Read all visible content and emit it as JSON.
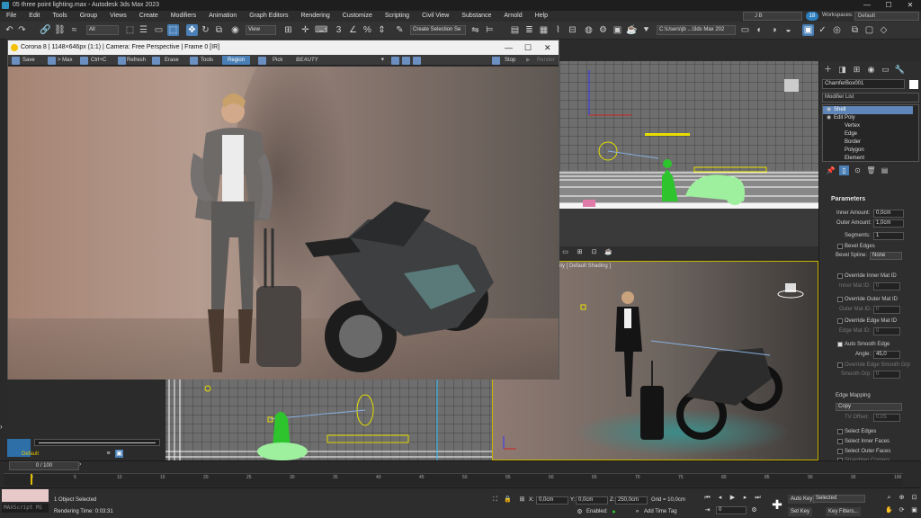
{
  "window": {
    "title": "05 three point lighting.max - Autodesk 3ds Max 2023",
    "min": "—",
    "max": "☐",
    "close": "✕"
  },
  "menu": [
    "File",
    "Edit",
    "Tools",
    "Group",
    "Views",
    "Create",
    "Modifiers",
    "Animation",
    "Graph Editors",
    "Rendering",
    "Customize",
    "Scripting",
    "Civil View",
    "Substance",
    "Arnold",
    "Help"
  ],
  "account": {
    "user": "J B",
    "help_badge": "18",
    "workspace_label": "Workspaces:",
    "workspace_value": "Default"
  },
  "toolbar": {
    "filter": "All",
    "view": "View",
    "selection_set": "Create Selection Se",
    "path": "C:\\Users\\jb ...\\3ds Max 202"
  },
  "render_window": {
    "title": "Corona 8 | 1148×646px (1:1) | Camera: Free Perspective | Frame 0 [IR]",
    "buttons": {
      "save": "Save",
      "to_max": "> Max",
      "copy": "Ctrl+C",
      "refresh": "Refresh",
      "erase": "Erase",
      "tools": "Tools",
      "region": "Region",
      "pick": "Pick",
      "channel": "BEAUTY",
      "stop": "Stop",
      "render": "Render"
    }
  },
  "viewport": {
    "label": "[ Default Shading ]",
    "label_prefix": "ity"
  },
  "command_panel": {
    "object_name": "ChamferBox001",
    "modifier_list": "Modifier List",
    "stack": [
      {
        "label": "Shell",
        "selected": true,
        "level": 0
      },
      {
        "label": "Edit Poly",
        "selected": false,
        "level": 0
      },
      {
        "label": "Vertex",
        "selected": false,
        "level": 1
      },
      {
        "label": "Edge",
        "selected": false,
        "level": 1
      },
      {
        "label": "Border",
        "selected": false,
        "level": 1
      },
      {
        "label": "Polygon",
        "selected": false,
        "level": 1
      },
      {
        "label": "Element",
        "selected": false,
        "level": 1
      }
    ],
    "params_title": "Parameters",
    "inner_amount_label": "Inner Amount:",
    "inner_amount": "0,0cm",
    "outer_amount_label": "Outer Amount:",
    "outer_amount": "1,0cm",
    "segments_label": "Segments:",
    "segments": "1",
    "bevel_edges": "Bevel Edges",
    "bevel_spline_label": "Bevel Spline:",
    "bevel_spline": "None",
    "override_inner": "Override Inner Mat ID",
    "inner_mat_label": "Inner Mat ID:",
    "inner_mat": "0",
    "override_outer": "Override Outer Mat ID",
    "outer_mat_label": "Outer Mat ID:",
    "outer_mat": "0",
    "override_edge": "Override Edge Mat ID",
    "edge_mat_label": "Edge Mat ID:",
    "edge_mat": "0",
    "auto_smooth": "Auto Smooth Edge",
    "angle_label": "Angle:",
    "angle": "45,0",
    "override_smooth": "Override Edge Smooth Grp",
    "smooth_grp_label": "Smooth Grp:",
    "smooth_grp": "0",
    "edge_mapping": "Edge Mapping",
    "edge_mapping_value": "Copy",
    "tv_offset_label": "TV Offset:",
    "tv_offset": "0,05",
    "select_edges": "Select Edges",
    "select_inner": "Select Inner Faces",
    "select_outer": "Select Outer Faces",
    "straighten": "Straighten Corners"
  },
  "timeline": {
    "range": "0 / 100",
    "ticks": [
      "0",
      "5",
      "10",
      "15",
      "20",
      "25",
      "30",
      "35",
      "40",
      "45",
      "50",
      "55",
      "60",
      "65",
      "70",
      "75",
      "80",
      "85",
      "90",
      "95",
      "100"
    ]
  },
  "status": {
    "selected": "1 Object Selected",
    "render_time": "Rendering Time: 0:03:31",
    "maxscript": "MAXScript Mi",
    "x_label": "X:",
    "x": "0,0cm",
    "y_label": "Y:",
    "y": "0,0cm",
    "z_label": "Z:",
    "z": "250,0cm",
    "grid": "Grid = 10,0cm",
    "enabled": "Enabled:",
    "add_time_tag": "Add Time Tag",
    "auto_key": "Auto Key",
    "set_key": "Set Key",
    "selected_dd": "Selected",
    "key_filters": "Key Filters...",
    "frame": "0"
  },
  "left_panel": {
    "layer": "Default"
  },
  "colors": {
    "accent": "#4a7fb5",
    "auto_key": "#a03030",
    "region": "#4a7fb5"
  }
}
